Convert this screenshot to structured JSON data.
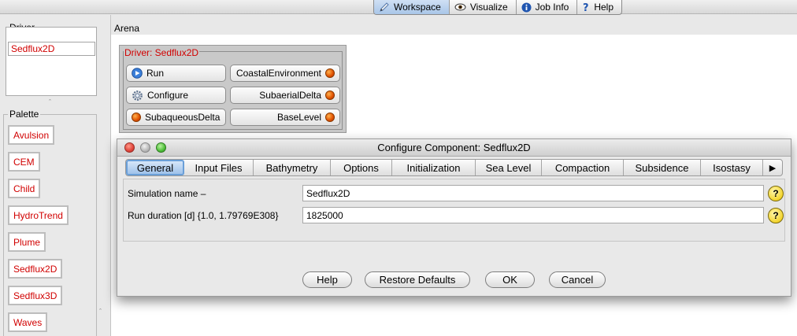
{
  "top_tabs": [
    {
      "label": "Workspace",
      "icon": "pencil-icon"
    },
    {
      "label": "Visualize",
      "icon": "eye-icon"
    },
    {
      "label": "Job Info",
      "icon": "info-icon"
    },
    {
      "label": "Help",
      "icon": "question-icon"
    }
  ],
  "driver": {
    "title": "Driver",
    "value": "Sedflux2D"
  },
  "palette": {
    "title": "Palette",
    "items": [
      "Avulsion",
      "CEM",
      "Child",
      "HydroTrend",
      "Plume",
      "Sedflux2D",
      "Sedflux3D",
      "Waves"
    ]
  },
  "arena": {
    "title": "Arena",
    "driver_panel": {
      "legend": "Driver: Sedflux2D",
      "buttons": [
        {
          "label": "Run",
          "icon": "play-icon"
        },
        {
          "label": "CoastalEnvironment",
          "icon": "status-dot-icon"
        },
        {
          "label": "Configure",
          "icon": "gear-icon"
        },
        {
          "label": "SubaerialDelta",
          "icon": "status-dot-icon"
        },
        {
          "label": "SubaqueousDelta",
          "icon": "status-dot-icon"
        },
        {
          "label": "BaseLevel",
          "icon": "status-dot-icon"
        }
      ],
      "status_color": "#e05000"
    }
  },
  "dialog": {
    "title": "Configure Component: Sedflux2D",
    "tabs": [
      "General",
      "Input Files",
      "Bathymetry",
      "Options",
      "Initialization",
      "Sea Level",
      "Compaction",
      "Subsidence",
      "Isostasy"
    ],
    "active_tab": "General",
    "fields": [
      {
        "label": "Simulation name –",
        "value": "Sedflux2D"
      },
      {
        "label": "Run duration [d] {1.0, 1.79769E308}",
        "value": "1825000"
      }
    ],
    "buttons": {
      "help": "Help",
      "restore": "Restore Defaults",
      "ok": "OK",
      "cancel": "Cancel"
    },
    "help_glyph": "?",
    "more_glyph": "▶"
  }
}
